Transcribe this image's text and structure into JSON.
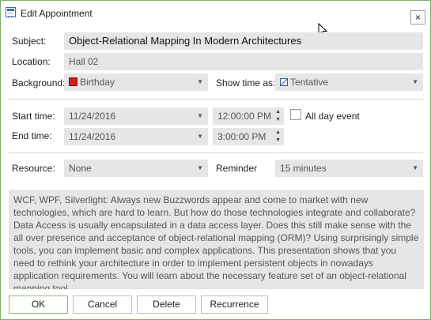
{
  "window": {
    "title": "Edit Appointment",
    "close_glyph": "×",
    "icon": "calendar-edit-icon"
  },
  "form": {
    "subject": {
      "label": "Subject:",
      "value": "Object-Relational Mapping In Modern Architectures"
    },
    "location": {
      "label": "Location:",
      "value": "Hall 02"
    },
    "background": {
      "label": "Background:",
      "value": "Birthday",
      "swatch_color": "#cc1f1f"
    },
    "show_time_as": {
      "label": "Show time as:",
      "value": "Tentative"
    },
    "start_time": {
      "label": "Start time:",
      "date": "11/24/2016",
      "time": "12:00:00 PM"
    },
    "end_time": {
      "label": "End time:",
      "date": "11/24/2016",
      "time": "3:00:00 PM"
    },
    "all_day": {
      "label": "All day event",
      "checked": false
    },
    "resource": {
      "label": "Resource:",
      "value": "None"
    },
    "reminder": {
      "label": "Reminder",
      "value": "15 minutes"
    },
    "description": "WCF, WPF, Silverlight: Always new Buzzwords appear and come to market with new technologies, which are hard to learn. But how do those technologies integrate and collaborate? Data Access is usually encapsulated in a data access layer. Does this still make sense with the all over presence and acceptance of object-relational mapping (ORM)? Using surprisingly simple tools, you can implement basic and complex applications. This presentation shows that you need to rethink your architecture in order to implement persistent objects in nowadays application requirements. You will learn about the necessary feature set of an object-relational mapping tool"
  },
  "buttons": {
    "ok": "OK",
    "cancel": "Cancel",
    "delete": "Delete",
    "recurrence": "Recurrence"
  },
  "colors": {
    "accent_border": "#7fb06a",
    "field_bg": "#e6e6e6"
  }
}
